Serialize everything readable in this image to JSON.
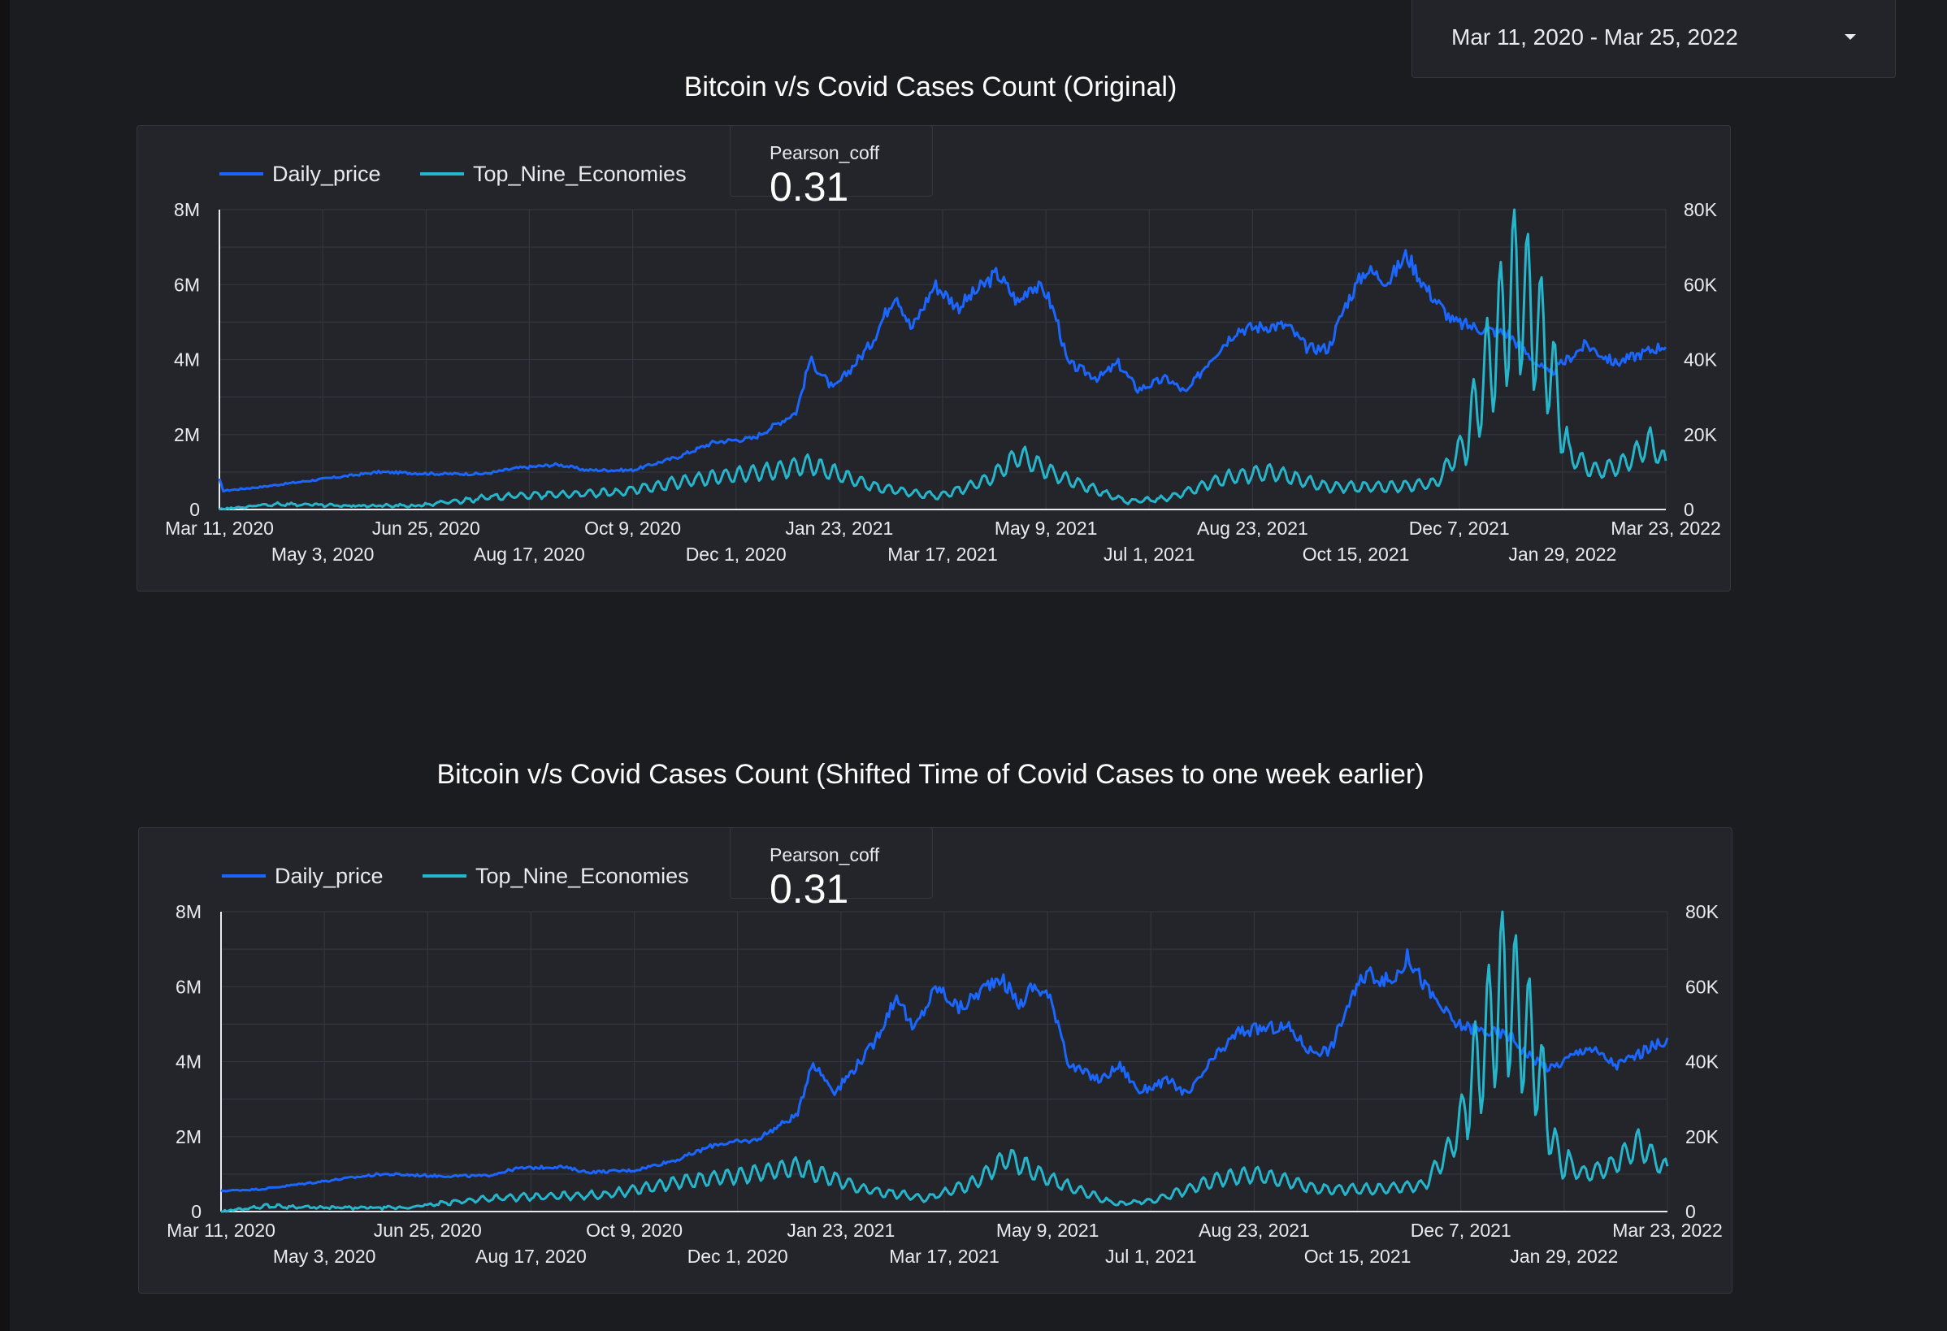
{
  "date_range": {
    "label": "Mar 11, 2020 - Mar 25, 2022"
  },
  "charts": [
    {
      "title": "Bitcoin v/s Covid Cases Count (Original)",
      "kpi_label": "Pearson_coff",
      "kpi_value": "0.31"
    },
    {
      "title": "Bitcoin v/s Covid Cases Count (Shifted Time of Covid Cases to one week earlier)",
      "kpi_label": "Pearson_coff",
      "kpi_value": "0.31"
    }
  ],
  "chart_data": [
    {
      "type": "line",
      "title": "Bitcoin v/s Covid Cases Count (Original)",
      "legend": [
        "Daily_price",
        "Top_Nine_Economies"
      ],
      "legend_position": "top-left",
      "grid": true,
      "colors": {
        "Daily_price": "#1a66ff",
        "Top_Nine_Economies": "#26b6cc"
      },
      "left_axis": {
        "ticks": [
          "0",
          "2M",
          "4M",
          "6M",
          "8M"
        ],
        "ylim": [
          0,
          8000000
        ]
      },
      "right_axis": {
        "ticks": [
          "0",
          "20K",
          "40K",
          "60K",
          "80K"
        ],
        "ylim": [
          0,
          80000
        ]
      },
      "x_ticks": [
        "Mar 11, 2020",
        "May 3, 2020",
        "Jun 25, 2020",
        "Aug 17, 2020",
        "Oct 9, 2020",
        "Dec 1, 2020",
        "Jan 23, 2021",
        "Mar 17, 2021",
        "May 9, 2021",
        "Jul 1, 2021",
        "Aug 23, 2021",
        "Oct 15, 2021",
        "Dec 7, 2021",
        "Jan 29, 2022",
        "Mar 23, 2022"
      ],
      "xlim": [
        "2020-03-11",
        "2022-03-25"
      ],
      "series": [
        {
          "name": "Daily_price",
          "axis": "left",
          "points": [
            [
              "2020-03-11",
              800000
            ],
            [
              "2020-03-13",
              500000
            ],
            [
              "2020-04-01",
              600000
            ],
            [
              "2020-05-01",
              800000
            ],
            [
              "2020-06-01",
              1000000
            ],
            [
              "2020-07-01",
              950000
            ],
            [
              "2020-07-25",
              950000
            ],
            [
              "2020-08-10",
              1100000
            ],
            [
              "2020-09-01",
              1200000
            ],
            [
              "2020-09-15",
              1050000
            ],
            [
              "2020-10-09",
              1050000
            ],
            [
              "2020-11-01",
              1400000
            ],
            [
              "2020-11-20",
              1800000
            ],
            [
              "2020-12-10",
              1900000
            ],
            [
              "2021-01-01",
              2600000
            ],
            [
              "2021-01-08",
              4000000
            ],
            [
              "2021-01-20",
              3200000
            ],
            [
              "2021-02-08",
              4400000
            ],
            [
              "2021-02-21",
              5800000
            ],
            [
              "2021-03-01",
              4800000
            ],
            [
              "2021-03-13",
              6000000
            ],
            [
              "2021-03-25",
              5400000
            ],
            [
              "2021-04-14",
              6300000
            ],
            [
              "2021-04-25",
              5500000
            ],
            [
              "2021-05-01",
              6000000
            ],
            [
              "2021-05-09",
              5800000
            ],
            [
              "2021-05-15",
              5000000
            ],
            [
              "2021-05-20",
              3900000
            ],
            [
              "2021-06-05",
              3500000
            ],
            [
              "2021-06-15",
              3900000
            ],
            [
              "2021-06-25",
              3200000
            ],
            [
              "2021-07-10",
              3500000
            ],
            [
              "2021-07-20",
              3100000
            ],
            [
              "2021-08-01",
              4000000
            ],
            [
              "2021-08-15",
              4800000
            ],
            [
              "2021-09-01",
              4900000
            ],
            [
              "2021-09-10",
              4900000
            ],
            [
              "2021-09-20",
              4300000
            ],
            [
              "2021-10-01",
              4300000
            ],
            [
              "2021-10-10",
              5500000
            ],
            [
              "2021-10-20",
              6400000
            ],
            [
              "2021-11-01",
              6100000
            ],
            [
              "2021-11-10",
              6800000
            ],
            [
              "2021-11-20",
              5900000
            ],
            [
              "2021-12-04",
              5000000
            ],
            [
              "2021-12-20",
              4800000
            ],
            [
              "2022-01-01",
              4700000
            ],
            [
              "2022-01-10",
              4200000
            ],
            [
              "2022-01-22",
              3600000
            ],
            [
              "2022-02-10",
              4400000
            ],
            [
              "2022-02-25",
              3900000
            ],
            [
              "2022-03-23",
              4400000
            ]
          ]
        },
        {
          "name": "Top_Nine_Economies",
          "axis": "right",
          "points": [
            [
              "2020-03-11",
              0
            ],
            [
              "2020-04-10",
              1500
            ],
            [
              "2020-05-10",
              1000
            ],
            [
              "2020-06-20",
              1000
            ],
            [
              "2020-08-01",
              3500
            ],
            [
              "2020-10-01",
              4500
            ],
            [
              "2020-11-10",
              8000
            ],
            [
              "2020-12-15",
              10000
            ],
            [
              "2021-01-08",
              12000
            ],
            [
              "2021-02-10",
              6000
            ],
            [
              "2021-03-15",
              3500
            ],
            [
              "2021-04-10",
              8000
            ],
            [
              "2021-04-25",
              14500
            ],
            [
              "2021-05-15",
              9000
            ],
            [
              "2021-06-20",
              2000
            ],
            [
              "2021-07-10",
              3000
            ],
            [
              "2021-08-10",
              8500
            ],
            [
              "2021-09-01",
              10000
            ],
            [
              "2021-10-01",
              6000
            ],
            [
              "2021-11-01",
              6000
            ],
            [
              "2021-11-25",
              7000
            ],
            [
              "2021-12-10",
              18000
            ],
            [
              "2021-12-20",
              35000
            ],
            [
              "2022-01-05",
              60000
            ],
            [
              "2022-01-15",
              50000
            ],
            [
              "2022-01-22",
              40000
            ],
            [
              "2022-02-01",
              15000
            ],
            [
              "2022-02-15",
              10000
            ],
            [
              "2022-03-01",
              12000
            ],
            [
              "2022-03-15",
              18000
            ],
            [
              "2022-03-23",
              12000
            ]
          ]
        }
      ]
    },
    {
      "type": "line",
      "title": "Bitcoin v/s Covid Cases Count (Shifted Time of Covid Cases to one week earlier)",
      "legend": [
        "Daily_price",
        "Top_Nine_Economies"
      ],
      "legend_position": "top-left",
      "grid": true,
      "colors": {
        "Daily_price": "#1a66ff",
        "Top_Nine_Economies": "#26b6cc"
      },
      "left_axis": {
        "ticks": [
          "0",
          "2M",
          "4M",
          "6M",
          "8M"
        ],
        "ylim": [
          0,
          8000000
        ]
      },
      "right_axis": {
        "ticks": [
          "0",
          "20K",
          "40K",
          "60K",
          "80K"
        ],
        "ylim": [
          0,
          80000
        ]
      },
      "x_ticks": [
        "Mar 11, 2020",
        "May 3, 2020",
        "Jun 25, 2020",
        "Aug 17, 2020",
        "Oct 9, 2020",
        "Dec 1, 2020",
        "Jan 23, 2021",
        "Mar 17, 2021",
        "May 9, 2021",
        "Jul 1, 2021",
        "Aug 23, 2021",
        "Oct 15, 2021",
        "Dec 7, 2021",
        "Jan 29, 2022",
        "Mar 23, 2022"
      ],
      "xlim": [
        "2020-03-11",
        "2022-03-25"
      ],
      "series": [
        {
          "name": "Daily_price",
          "axis": "left",
          "points": [
            [
              "2020-03-11",
              550000
            ],
            [
              "2020-04-01",
              600000
            ],
            [
              "2020-05-01",
              800000
            ],
            [
              "2020-06-01",
              1000000
            ],
            [
              "2020-07-01",
              950000
            ],
            [
              "2020-07-25",
              950000
            ],
            [
              "2020-08-10",
              1150000
            ],
            [
              "2020-09-01",
              1200000
            ],
            [
              "2020-09-15",
              1050000
            ],
            [
              "2020-10-09",
              1100000
            ],
            [
              "2020-11-01",
              1400000
            ],
            [
              "2020-11-20",
              1800000
            ],
            [
              "2020-12-10",
              1900000
            ],
            [
              "2021-01-01",
              2600000
            ],
            [
              "2021-01-08",
              4000000
            ],
            [
              "2021-01-20",
              3200000
            ],
            [
              "2021-02-08",
              4400000
            ],
            [
              "2021-02-21",
              5800000
            ],
            [
              "2021-03-01",
              4800000
            ],
            [
              "2021-03-13",
              6000000
            ],
            [
              "2021-03-25",
              5400000
            ],
            [
              "2021-04-14",
              6300000
            ],
            [
              "2021-04-25",
              5500000
            ],
            [
              "2021-05-01",
              6000000
            ],
            [
              "2021-05-09",
              5800000
            ],
            [
              "2021-05-15",
              5000000
            ],
            [
              "2021-05-20",
              3900000
            ],
            [
              "2021-06-05",
              3500000
            ],
            [
              "2021-06-15",
              3900000
            ],
            [
              "2021-06-25",
              3200000
            ],
            [
              "2021-07-10",
              3500000
            ],
            [
              "2021-07-20",
              3100000
            ],
            [
              "2021-08-01",
              4000000
            ],
            [
              "2021-08-15",
              4800000
            ],
            [
              "2021-09-01",
              4900000
            ],
            [
              "2021-09-10",
              4900000
            ],
            [
              "2021-09-20",
              4300000
            ],
            [
              "2021-10-01",
              4300000
            ],
            [
              "2021-10-10",
              5500000
            ],
            [
              "2021-10-20",
              6400000
            ],
            [
              "2021-11-01",
              6100000
            ],
            [
              "2021-11-10",
              6800000
            ],
            [
              "2021-11-20",
              5900000
            ],
            [
              "2021-12-04",
              5000000
            ],
            [
              "2021-12-20",
              4800000
            ],
            [
              "2022-01-01",
              4700000
            ],
            [
              "2022-01-10",
              4200000
            ],
            [
              "2022-01-22",
              3800000
            ],
            [
              "2022-02-10",
              4400000
            ],
            [
              "2022-02-25",
              3900000
            ],
            [
              "2022-03-23",
              4600000
            ]
          ]
        },
        {
          "name": "Top_Nine_Economies",
          "axis": "right",
          "points": [
            [
              "2020-03-11",
              0
            ],
            [
              "2020-04-03",
              1500
            ],
            [
              "2020-05-03",
              1000
            ],
            [
              "2020-06-13",
              1000
            ],
            [
              "2020-07-25",
              3500
            ],
            [
              "2020-09-24",
              4500
            ],
            [
              "2020-11-03",
              8000
            ],
            [
              "2020-12-08",
              10000
            ],
            [
              "2021-01-01",
              12000
            ],
            [
              "2021-02-03",
              6000
            ],
            [
              "2021-03-08",
              3500
            ],
            [
              "2021-04-03",
              8000
            ],
            [
              "2021-04-18",
              14500
            ],
            [
              "2021-05-08",
              9000
            ],
            [
              "2021-06-13",
              2000
            ],
            [
              "2021-07-03",
              3000
            ],
            [
              "2021-08-03",
              8500
            ],
            [
              "2021-08-25",
              10000
            ],
            [
              "2021-09-24",
              6000
            ],
            [
              "2021-10-25",
              6000
            ],
            [
              "2021-11-18",
              7000
            ],
            [
              "2021-12-03",
              18000
            ],
            [
              "2021-12-13",
              35000
            ],
            [
              "2021-12-29",
              60000
            ],
            [
              "2022-01-08",
              50000
            ],
            [
              "2022-01-15",
              40000
            ],
            [
              "2022-01-25",
              15000
            ],
            [
              "2022-02-08",
              10000
            ],
            [
              "2022-02-22",
              12000
            ],
            [
              "2022-03-08",
              18000
            ],
            [
              "2022-03-23",
              11000
            ]
          ]
        }
      ]
    }
  ]
}
